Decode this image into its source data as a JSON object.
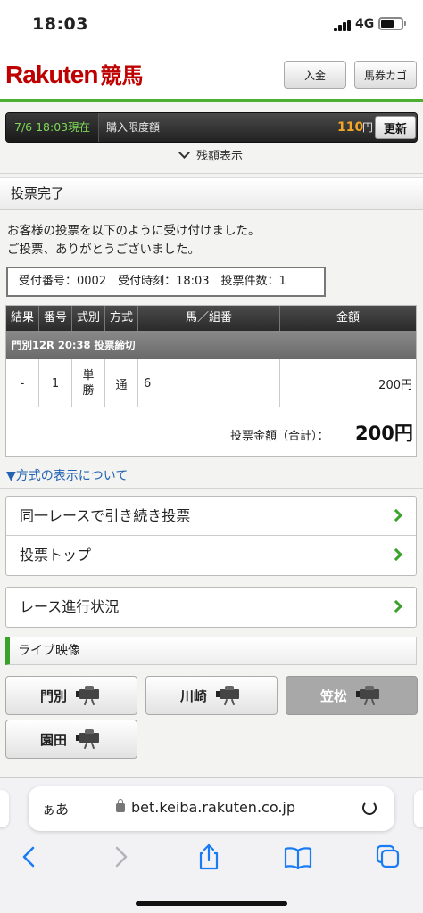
{
  "status_bar": {
    "time": "18:03",
    "network": "4G"
  },
  "header": {
    "logo_text": "Rakuten",
    "logo_kanji": "競馬",
    "deposit_label": "入金",
    "cart_label": "馬券カゴ"
  },
  "balance": {
    "timestamp": "7/6 18:03現在",
    "limit_label": "購入限度額",
    "amount": "110",
    "unit": "円",
    "refresh_label": "更新",
    "show_label": "残額表示"
  },
  "section_title": "投票完了",
  "message": {
    "line1": "お客様の投票を以下のように受け付けました。",
    "line2": "ご投票、ありがとうございました。"
  },
  "receipt": "受付番号：0002　受付時刻：18:03　投票件数：1",
  "table": {
    "headers": [
      "結果",
      "番号",
      "式別",
      "方式",
      "馬／組番",
      "金額"
    ],
    "race_info": "門別12R 20:38 投票締切",
    "rows": [
      {
        "result": "-",
        "number": "1",
        "kind_line1": "単",
        "kind_line2": "勝",
        "method": "通",
        "horse": "6",
        "amount": "200円"
      }
    ],
    "total_label": "投票金額（合計）：",
    "total_value": "200円"
  },
  "method_link": "▼方式の表示について",
  "menu": {
    "continue_label": "同一レースで引き続き投票",
    "top_label": "投票トップ",
    "race_status_label": "レース進行状況"
  },
  "live": {
    "header": "ライブ映像",
    "venues": [
      "門別",
      "川崎",
      "笠松",
      "園田"
    ]
  },
  "browser": {
    "aa_label": "ぁあ",
    "url": "bet.keiba.rakuten.co.jp"
  },
  "colors": {
    "brand_red": "#bf0000",
    "accent_green": "#3aa22b",
    "amount_orange": "#f5a623",
    "link_blue": "#2463b3"
  }
}
